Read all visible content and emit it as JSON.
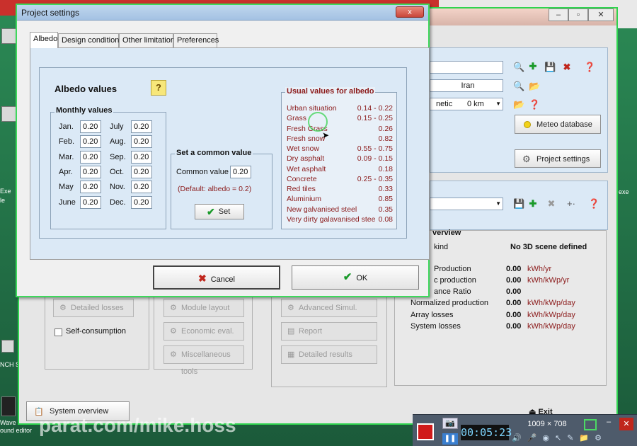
{
  "background": {
    "left_labels": [
      "Exe",
      "le",
      "xe"
    ],
    "left_bottom": {
      "lines": [
        "NCH S",
        "Wave",
        "ound editor"
      ]
    }
  },
  "main": {
    "site_field": "Iran",
    "meteo_field": "netic",
    "distance_field": "0 km",
    "meteo_button": "Meteo database",
    "project_settings_button": "Project settings",
    "overview_title": "verview",
    "scene_kind_label": "kind",
    "scene_kind_value": "No 3D scene defined",
    "results": [
      {
        "label": "Production",
        "value": "0.00",
        "unit": "kWh/yr"
      },
      {
        "label": "c production",
        "value": "0.00",
        "unit": "kWh/kWp/yr"
      },
      {
        "label": "ance Ratio",
        "value": "0.00",
        "unit": ""
      },
      {
        "label": "Normalized production",
        "value": "0.00",
        "unit": "kWh/kWp/day"
      },
      {
        "label": "Array losses",
        "value": "0.00",
        "unit": "kWh/kWp/day"
      },
      {
        "label": "System losses",
        "value": "0.00",
        "unit": "kWh/kWp/day"
      }
    ],
    "buttons": {
      "detailed_losses": "Detailed losses",
      "self_consumption": "Self-consumption",
      "module_layout": "Module layout",
      "economic_eval": "Economic eval.",
      "misc_tools": "Miscellaneous tools",
      "advanced_simul": "Advanced Simul.",
      "report": "Report",
      "detailed_results": "Detailed results",
      "system_overview": "System overview",
      "exit": "Exit"
    },
    "right_edge_label": "exe"
  },
  "dialog": {
    "title": "Project settings",
    "close_label": "x",
    "tabs": [
      "Albedo",
      "Design conditions",
      "Other limitations",
      "Preferences"
    ],
    "albedo_heading": "Albedo values",
    "help_label": "?",
    "monthly_title": "Monthly values",
    "months_left": [
      {
        "label": "Jan.",
        "value": "0.20"
      },
      {
        "label": "Feb.",
        "value": "0.20"
      },
      {
        "label": "Mar.",
        "value": "0.20"
      },
      {
        "label": "Apr.",
        "value": "0.20"
      },
      {
        "label": "May",
        "value": "0.20"
      },
      {
        "label": "June",
        "value": "0.20"
      }
    ],
    "months_right": [
      {
        "label": "July",
        "value": "0.20"
      },
      {
        "label": "Aug.",
        "value": "0.20"
      },
      {
        "label": "Sep.",
        "value": "0.20"
      },
      {
        "label": "Oct.",
        "value": "0.20"
      },
      {
        "label": "Nov.",
        "value": "0.20"
      },
      {
        "label": "Dec.",
        "value": "0.20"
      }
    ],
    "common_title": "Set a common value",
    "common_label": "Common value",
    "common_value": "0.20",
    "default_note": "(Default: albedo = 0.2)",
    "set_button": "Set",
    "usual_title": "Usual values for albedo",
    "usual_values": [
      {
        "name": "Urban situation",
        "value": "0.14 - 0.22"
      },
      {
        "name": "Grass",
        "value": "0.15 - 0.25"
      },
      {
        "name": "Fresh Grass",
        "value": "0.26"
      },
      {
        "name": "Fresh snow",
        "value": "0.82"
      },
      {
        "name": "Wet snow",
        "value": "0.55 - 0.75"
      },
      {
        "name": "Dry asphalt",
        "value": "0.09 - 0.15"
      },
      {
        "name": "Wet asphalt",
        "value": "0.18"
      },
      {
        "name": "Concrete",
        "value": "0.25 - 0.35"
      },
      {
        "name": "Red tiles",
        "value": "0.33"
      },
      {
        "name": "Aluminium",
        "value": "0.85"
      },
      {
        "name": "New galvanised steel",
        "value": "0.35"
      },
      {
        "name": "Very dirty galavanised stee",
        "value": "0.08"
      }
    ],
    "cancel_button": "Cancel",
    "ok_button": "OK"
  },
  "recorder": {
    "timer": "00:05:23",
    "resolution": "1009 × 708"
  },
  "watermark": "parat.com/mike.hoss",
  "colors": {
    "ok_check": "#1a9a2a",
    "cancel_x": "#c0261c",
    "help_bg": "#f7e77a",
    "highlight_ring": "#44d45a"
  }
}
